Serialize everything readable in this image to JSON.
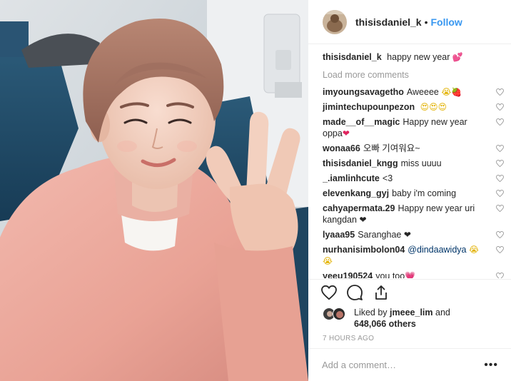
{
  "post": {
    "username": "thisisdaniel_k",
    "separator": "•",
    "follow_label": "Follow",
    "caption_user": "thisisdaniel_k",
    "caption_text": "happy new year",
    "caption_emoji": "💕",
    "load_more": "Load more comments"
  },
  "comments": [
    {
      "user": "imyoungsavagetho",
      "text": "Aweeee",
      "emoji": "😭🍓"
    },
    {
      "user": "jimintechupounpezon",
      "text": "",
      "emoji": "😍😍😍"
    },
    {
      "user": "made__of__magic",
      "text": "Happy new year oppa",
      "emoji": "❤"
    },
    {
      "user": "wonaa66",
      "text": "오빠 기여워요~",
      "emoji": ""
    },
    {
      "user": "thisisdaniel_kngg",
      "text": "miss uuuu",
      "emoji": ""
    },
    {
      "user": "_.iamlinhcute",
      "text": "<3",
      "emoji": ""
    },
    {
      "user": "elevenkang_gyj",
      "text": "baby i'm coming",
      "emoji": ""
    },
    {
      "user": "cahyapermata.29",
      "text": "Happy new year uri kangdan",
      "emoji": "❤"
    },
    {
      "user": "lyaaa95",
      "text": "Saranghae",
      "emoji": "❤"
    },
    {
      "user": "nurhanisimbolon04",
      "mention": "@dindaawidya",
      "text": "",
      "emoji": "😭😭"
    },
    {
      "user": "yeeu190524",
      "text": "you too",
      "emoji": "💗"
    }
  ],
  "likes": {
    "prefix": "Liked by",
    "user": "jmeee_lim",
    "connector": "and",
    "count": "648,066 others"
  },
  "timestamp": "7 HOURS AGO",
  "add_comment": {
    "placeholder": "Add a comment…",
    "more": "•••"
  },
  "icons": {
    "like": "heart-outline-icon",
    "comment": "comment-bubble-icon",
    "share": "share-upload-icon",
    "save": "bookmark-icon",
    "comment_like": "small-heart-icon"
  },
  "colors": {
    "follow": "#3897f0",
    "muted": "#999999",
    "mention": "#003569"
  }
}
